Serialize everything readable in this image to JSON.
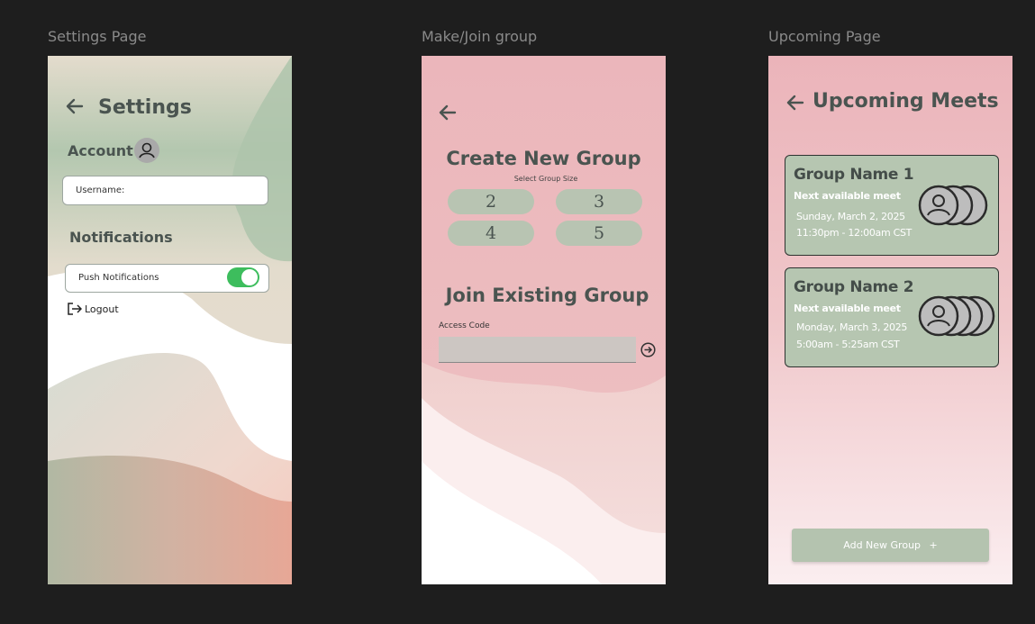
{
  "frames": {
    "settings": {
      "label": "Settings Page"
    },
    "group": {
      "label": "Make/Join group"
    },
    "upcoming": {
      "label": "Upcoming Page"
    }
  },
  "settings": {
    "title": "Settings",
    "account_label": "Account",
    "username_label": "Username:",
    "notifications_title": "Notifications",
    "push_label": "Push Notifications",
    "push_enabled": true,
    "logout_label": "Logout"
  },
  "group": {
    "create_title": "Create New Group",
    "size_label": "Select Group Size",
    "sizes": [
      "2",
      "3",
      "4",
      "5"
    ],
    "join_title": "Join Existing Group",
    "access_label": "Access Code",
    "access_value": ""
  },
  "upcoming": {
    "title": "Upcoming Meets",
    "groups": [
      {
        "name": "Group Name 1",
        "meet_label": "Next available meet",
        "date": "Sunday, March 2, 2025",
        "time": "11:30pm - 12:00am CST"
      },
      {
        "name": "Group Name 2",
        "meet_label": "Next available meet",
        "date": "Monday, March 3, 2025",
        "time": "5:00am - 5:25am CST"
      }
    ],
    "add_button": "Add New Group",
    "add_icon": "+"
  },
  "colors": {
    "background": "#1e1e1e",
    "sage": "#b6c6b1",
    "pink": "#ebb5bb",
    "toggle_on": "#3dbd5d",
    "text_dark": "#4a5450"
  },
  "icons": [
    "back-arrow-icon",
    "user-icon",
    "logout-icon",
    "arrow-circle-right-icon",
    "avatar-group-icon",
    "plus-icon"
  ]
}
